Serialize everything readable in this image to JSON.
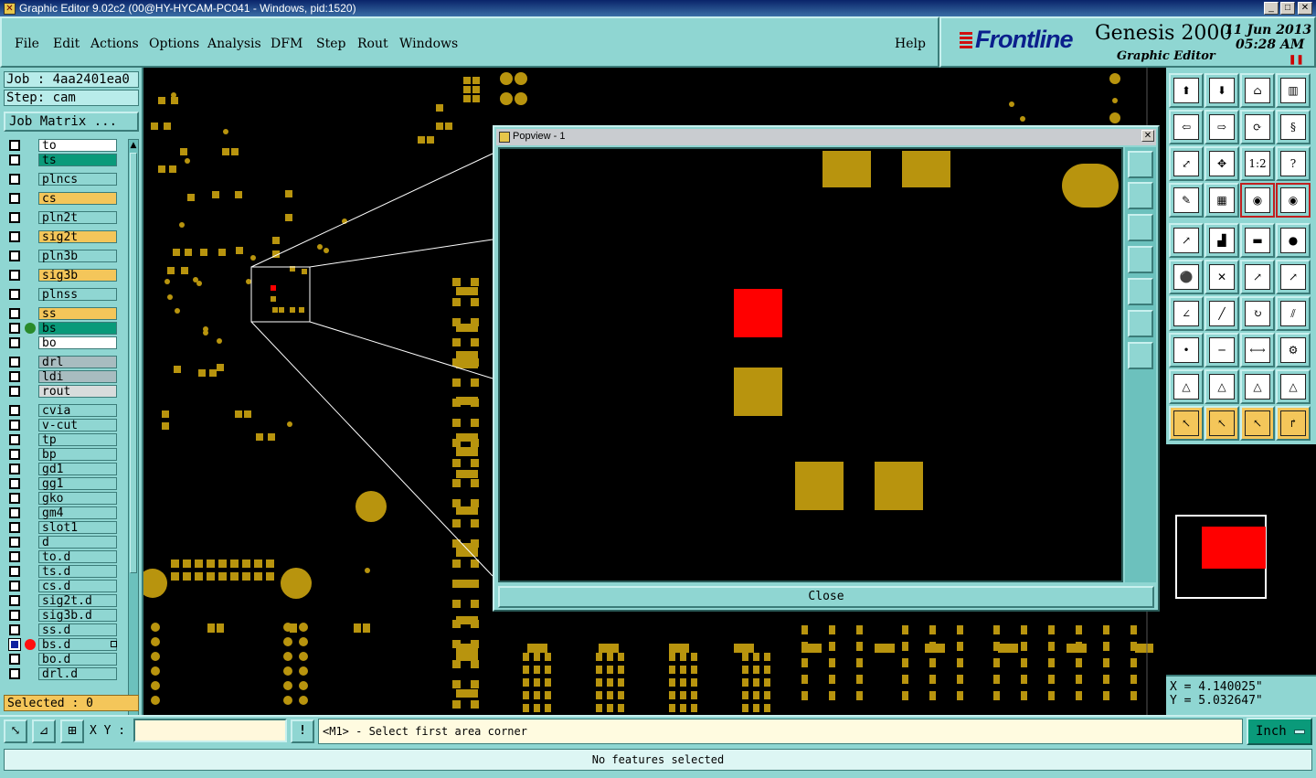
{
  "window": {
    "title": "Graphic Editor 9.02c2 (00@HY-HYCAM-PC041 - Windows, pid:1520)"
  },
  "menu": {
    "items": [
      "File",
      "Edit",
      "Actions",
      "Options",
      "Analysis",
      "DFM",
      "Step",
      "Rout",
      "Windows"
    ],
    "help": "Help"
  },
  "brand": {
    "logo": "Frontline",
    "product": "Genesis 2000",
    "subtitle": "Graphic Editor",
    "date": "11 Jun 2013",
    "time": "05:28 AM"
  },
  "job": {
    "job_label": "Job : 4aa2401ea0",
    "step_label": "Step: cam",
    "matrix_button": "Job Matrix ...",
    "selected": "Selected : 0"
  },
  "layers": [
    {
      "name": "to",
      "color": "w"
    },
    {
      "name": "ts",
      "color": "g"
    },
    {
      "name": "plncs",
      "color": "c"
    },
    {
      "name": "cs",
      "color": "o"
    },
    {
      "name": "pln2t",
      "color": "c"
    },
    {
      "name": "sig2t",
      "color": "o"
    },
    {
      "name": "pln3b",
      "color": "c"
    },
    {
      "name": "sig3b",
      "color": "o"
    },
    {
      "name": "plnss",
      "color": "c"
    },
    {
      "name": "ss",
      "color": "o"
    },
    {
      "name": "bs",
      "color": "g",
      "dot": "#2a8a2a"
    },
    {
      "name": "bo",
      "color": "w"
    },
    {
      "name": "drl",
      "color": "gr"
    },
    {
      "name": "ldi",
      "color": "gr"
    },
    {
      "name": "rout",
      "color": "lg"
    },
    {
      "name": "cvia",
      "color": "c"
    },
    {
      "name": "v-cut",
      "color": "c"
    },
    {
      "name": "tp",
      "color": "c"
    },
    {
      "name": "bp",
      "color": "c"
    },
    {
      "name": "gd1",
      "color": "c"
    },
    {
      "name": "gg1",
      "color": "c"
    },
    {
      "name": "gko",
      "color": "c"
    },
    {
      "name": "gm4",
      "color": "c"
    },
    {
      "name": "slot1",
      "color": "c"
    },
    {
      "name": "d",
      "color": "c"
    },
    {
      "name": "to.d",
      "color": "c"
    },
    {
      "name": "ts.d",
      "color": "c"
    },
    {
      "name": "cs.d",
      "color": "c"
    },
    {
      "name": "sig2t.d",
      "color": "c"
    },
    {
      "name": "sig3b.d",
      "color": "c"
    },
    {
      "name": "ss.d",
      "color": "c"
    },
    {
      "name": "bs.d",
      "color": "c",
      "dot": "#ff1010",
      "selected": true
    },
    {
      "name": "bo.d",
      "color": "c"
    },
    {
      "name": "drl.d",
      "color": "c"
    }
  ],
  "popview": {
    "title": "Popview - 1",
    "close_button": "Close"
  },
  "coords": {
    "x": "X = 4.140025\"",
    "y": "Y = 5.032647\""
  },
  "bottom": {
    "xy_label": "X Y :",
    "xy_value": "",
    "warn_button": "!",
    "prompt": "<M1> - Select first area corner",
    "unit": "Inch",
    "status": "No features selected"
  },
  "colors": {
    "panel": "#8fd6d2",
    "pad": "#b8940e",
    "highlight": "#ff0000"
  }
}
